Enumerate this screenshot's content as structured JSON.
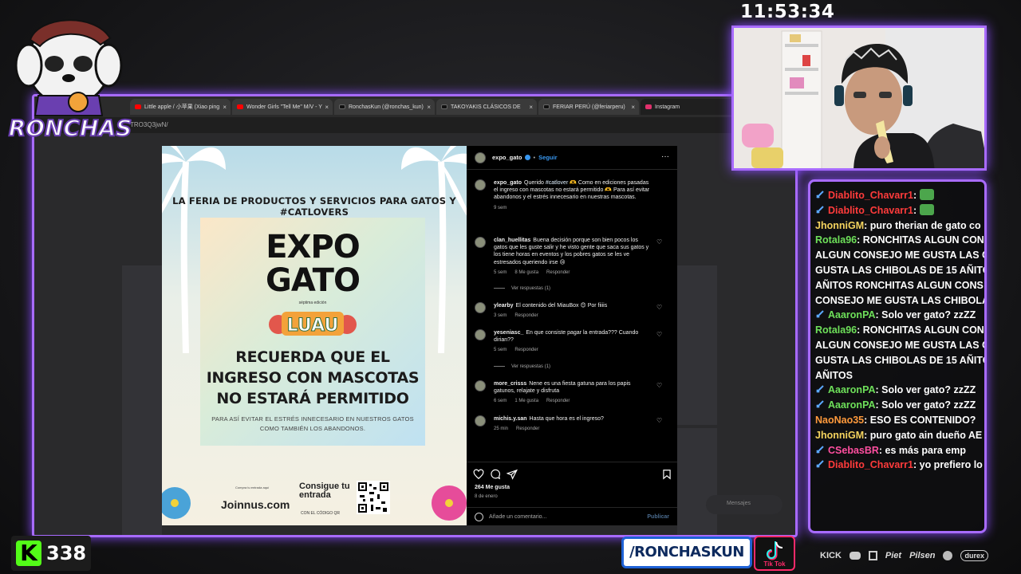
{
  "clock": "11:53:34",
  "streamer_logo_text": "RONCHAS",
  "browser": {
    "tabs": [
      {
        "label": "Little apple / 小苹果 (Xiao ping",
        "color": "#ff0000"
      },
      {
        "label": "Wonder Girls \"Tell Me\" M/V - Y",
        "color": "#ff0000"
      },
      {
        "label": "RonchasKun (@ronchas_kun)",
        "color": "#111111"
      },
      {
        "label": "TAKOYAKIS CLÁSICOS DE",
        "color": "#111111"
      },
      {
        "label": "FERIAR PERÚ (@feriarperu)",
        "color": "#111111"
      },
      {
        "label": "Instagram",
        "color": "#e1306c"
      }
    ],
    "address": "TRO3Q3jwN/"
  },
  "poster": {
    "headline": "LA FERIA DE PRODUCTOS Y SERVICIOS PARA GATOS Y #CATLOVERS",
    "expo": "EXPO",
    "gato": "GATO",
    "edition": "séptima edición",
    "luau": "LUAU",
    "remind_1": "RECUERDA QUE EL",
    "remind_2": "INGRESO CON MASCOTAS",
    "remind_3": "NO ESTARÁ PERMITIDO",
    "sub_1": "PARA ASÍ EVITAR EL ESTRÉS INNECESARIO EN NUESTROS GATOS",
    "sub_2": "COMO TAMBIÉN LOS ABANDONOS.",
    "joinnus_tag": "Compra tu entrada aquí",
    "joinnus": "Joinnus.com",
    "consigue": "Consigue tu entrada",
    "codigo": "CON EL CÓDIGO QR"
  },
  "instagram": {
    "header": {
      "username": "expo_gato",
      "follow": "Seguir",
      "more": "···"
    },
    "caption": {
      "username": "expo_gato",
      "text_a": "Querido ",
      "hashtag": "#catlover",
      "text_b": " 🫶 Como en ediciones pasadas el ingreso con mascotas no estará permitido 🫶 Para así evitar abandonos y el estrés innecesario en nuestras mascotas.",
      "time": "9 sem"
    },
    "comments": [
      {
        "user": "clan_huellitas",
        "text": "Buena decisión porque son bien pocos los gatos que les guste salir y he visto gente que saca sus gatos y los tiene horas en eventos y los pobres gatos se les ve estresados queriendo irse 😢",
        "time": "5 sem",
        "likes": "8 Me gusta",
        "reply": "Responder",
        "replies": "Ver respuestas (1)"
      },
      {
        "user": "ylearby",
        "text": "El contenido del MiauBox 😊 Por fiiiis",
        "time": "3 sem",
        "likes": "",
        "reply": "Responder",
        "replies": ""
      },
      {
        "user": "yeseniasc_",
        "text": "En que consiste pagar la entrada??? Cuando dirian??",
        "time": "5 sem",
        "likes": "",
        "reply": "Responder",
        "replies": "Ver respuestas (1)"
      },
      {
        "user": "more_crisss",
        "text": "Nene es una fiesta gatuna para los papis gatunos, relajate y disfruta",
        "time": "6 sem",
        "likes": "1 Me gusta",
        "reply": "Responder",
        "replies": ""
      },
      {
        "user": "michis.y.san",
        "text": "Hasta que hora es el ingreso?",
        "time": "25 min",
        "likes": "",
        "reply": "Responder",
        "replies": ""
      }
    ],
    "likes": "264 Me gusta",
    "date": "8 de enero",
    "comment_placeholder": "Añade un comentario...",
    "publish": "Publicar",
    "messages": "Mensajes"
  },
  "chat": [
    {
      "user": "Diablito_Chavarr1",
      "color": "#ff3b3b",
      "text": ":",
      "emote": true,
      "badge": "#5ba8ff"
    },
    {
      "user": "Diablito_Chavarr1",
      "color": "#ff3b3b",
      "text": ":",
      "emote": true,
      "badge": "#5ba8ff"
    },
    {
      "user": "JhonniGM",
      "color": "#f4d35e",
      "text": ": puro therian de gato co",
      "emote": false,
      "badge": ""
    },
    {
      "user": "Rotala96",
      "color": "#6ee05a",
      "text": ": RONCHITAS ALGUN CON",
      "emote": false,
      "badge": ""
    },
    {
      "user": "",
      "color": "#ffffff",
      "text": "ALGUN CONSEJO ME GUSTA LAS C",
      "emote": false,
      "badge": ""
    },
    {
      "user": "",
      "color": "#ffffff",
      "text": "GUSTA LAS CHIBOLAS DE 15 AÑITO",
      "emote": false,
      "badge": ""
    },
    {
      "user": "",
      "color": "#ffffff",
      "text": "AÑITOS RONCHITAS ALGUN CONS",
      "emote": false,
      "badge": ""
    },
    {
      "user": "",
      "color": "#ffffff",
      "text": "CONSEJO ME GUSTA LAS CHIBOLA",
      "emote": false,
      "badge": ""
    },
    {
      "user": "AaaronPA",
      "color": "#6ee05a",
      "text": ": Solo ver gato? zzZZ",
      "emote": false,
      "badge": "#5ba8ff"
    },
    {
      "user": "Rotala96",
      "color": "#6ee05a",
      "text": ": RONCHITAS ALGUN CON",
      "emote": false,
      "badge": ""
    },
    {
      "user": "",
      "color": "#ffffff",
      "text": "ALGUN CONSEJO ME GUSTA LAS C",
      "emote": false,
      "badge": ""
    },
    {
      "user": "",
      "color": "#ffffff",
      "text": "GUSTA LAS CHIBOLAS DE 15 AÑITO",
      "emote": false,
      "badge": ""
    },
    {
      "user": "",
      "color": "#ffffff",
      "text": "AÑITOS",
      "emote": false,
      "badge": ""
    },
    {
      "user": "AaaronPA",
      "color": "#6ee05a",
      "text": ": Solo ver gato? zzZZ",
      "emote": false,
      "badge": "#5ba8ff"
    },
    {
      "user": "AaaronPA",
      "color": "#6ee05a",
      "text": ": Solo ver gato? zzZZ",
      "emote": false,
      "badge": "#5ba8ff"
    },
    {
      "user": "NaoNao35",
      "color": "#ff9a3c",
      "text": ": ESO ES CONTENIDO?",
      "emote": false,
      "badge": ""
    },
    {
      "user": "JhonniGM",
      "color": "#f4d35e",
      "text": ": puro gato ain dueño AE",
      "emote": false,
      "badge": ""
    },
    {
      "user": "CSebasBR",
      "color": "#ff4fa0",
      "text": ": es más para emp",
      "emote": false,
      "badge": "#5ba8ff"
    },
    {
      "user": "Diablito_Chavarr1",
      "color": "#ff3b3b",
      "text": ": yo prefiero lo",
      "emote": false,
      "badge": "#5ba8ff"
    }
  ],
  "kick": {
    "letter": "K",
    "count": "338"
  },
  "handle": "/RONCHASKUN",
  "tiktok_label": "Tik Tok",
  "sponsors": [
    "KICK",
    "Piet",
    "Pilsen",
    "durex"
  ]
}
